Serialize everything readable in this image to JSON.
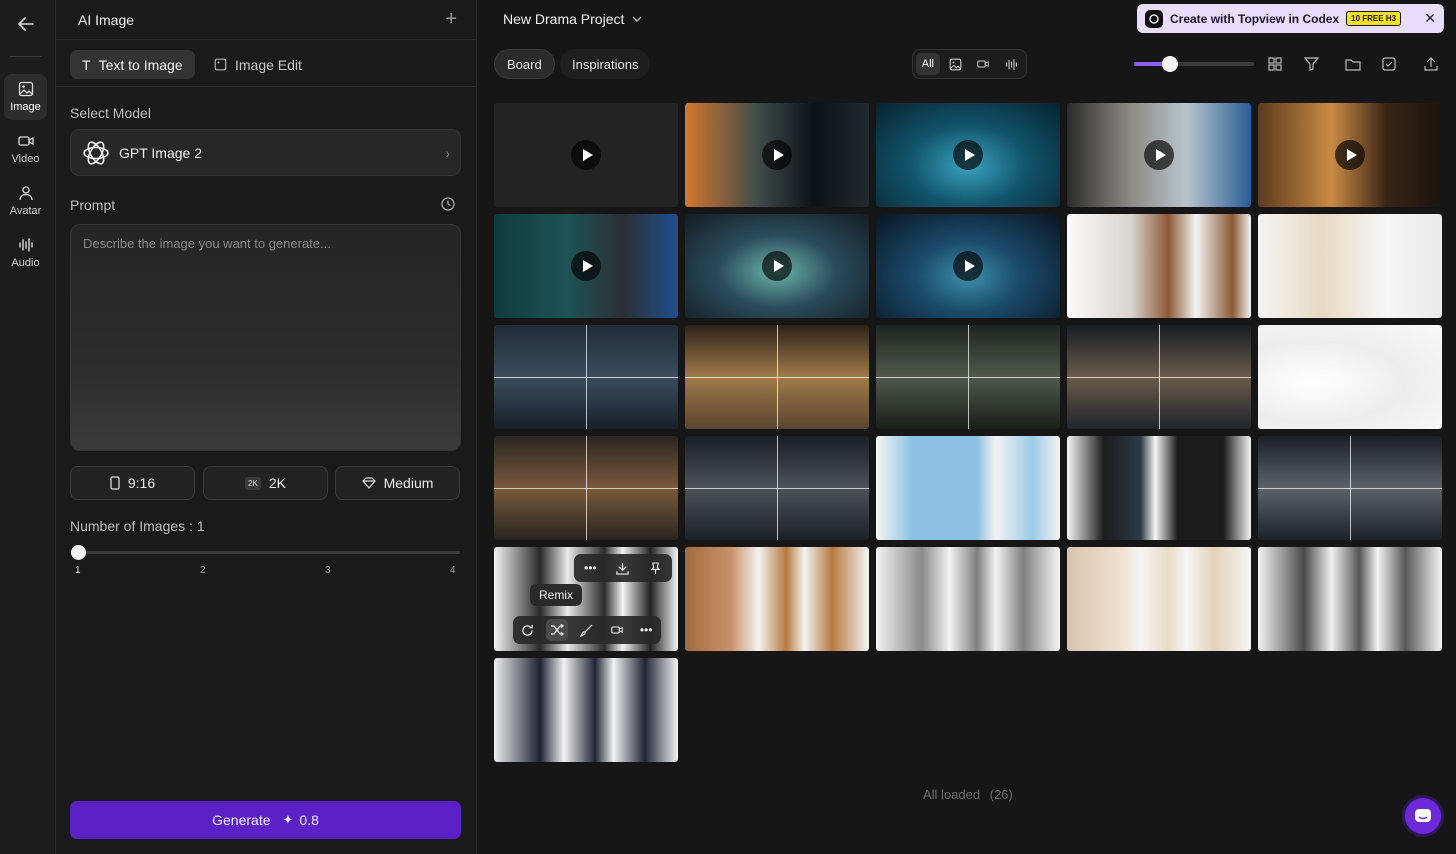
{
  "rail": {
    "items": [
      {
        "label": "Image",
        "icon": "image-icon"
      },
      {
        "label": "Video",
        "icon": "video-icon"
      },
      {
        "label": "Avatar",
        "icon": "avatar-icon"
      },
      {
        "label": "Audio",
        "icon": "audio-icon"
      }
    ]
  },
  "panel": {
    "title": "AI Image",
    "tabs": [
      {
        "label": "Text to Image",
        "active": true
      },
      {
        "label": "Image Edit",
        "active": false
      }
    ],
    "select_model_label": "Select Model",
    "model_name": "GPT Image 2",
    "prompt_label": "Prompt",
    "prompt_placeholder": "Describe the image you want to generate...",
    "options": {
      "aspect": "9:16",
      "resolution_chip": "2K",
      "resolution": "2K",
      "quality": "Medium"
    },
    "num_images_label": "Number of Images : 1",
    "num_images_ticks": [
      "1",
      "2",
      "3",
      "4"
    ],
    "num_images_selected": 1,
    "generate_label": "Generate",
    "generate_cost": "0.8"
  },
  "main": {
    "project_name": "New Drama Project",
    "promo_text": "Create with Topview in Codex",
    "promo_badge": "10 FREE H3",
    "tabs": [
      {
        "label": "Board",
        "active": true
      },
      {
        "label": "Inspirations",
        "active": false
      }
    ],
    "filter_all_label": "All",
    "zoom_level": 0.3,
    "tooltip": "Remix",
    "footer_status": "All loaded",
    "footer_count": "(26)"
  },
  "colors": {
    "accent": "#5b21c6",
    "promo_bg": "#e9ddfc",
    "badge": "#f8e11a",
    "slider": "#8b5cf6"
  }
}
